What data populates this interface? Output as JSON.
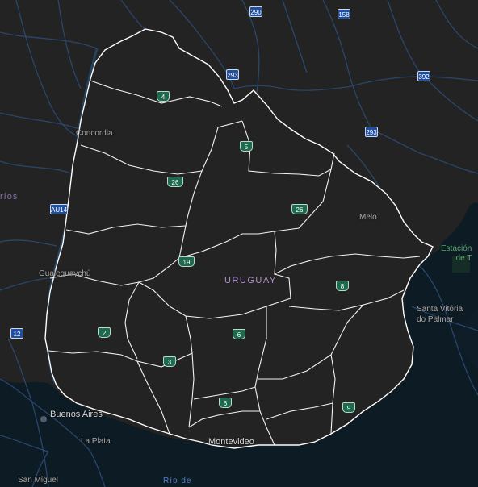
{
  "map": {
    "country_label": "URUGUAY",
    "colors": {
      "land": "#232323",
      "ocean": "#0d1b24",
      "roads": "#2d4d78",
      "borders": "#ffffff",
      "labels": "#a8a8a8"
    },
    "places": [
      {
        "id": "concordia",
        "name": "Concordia"
      },
      {
        "id": "gualeguaychu",
        "name": "Gualeguaychú"
      },
      {
        "id": "melo",
        "name": "Melo"
      },
      {
        "id": "santa-vitoria",
        "name": "Santa Vitória\ndo Palmar"
      },
      {
        "id": "buenos-aires",
        "name": "Buenos Aires"
      },
      {
        "id": "la-plata",
        "name": "La Plata"
      },
      {
        "id": "san-miguel",
        "name": "San Miguel"
      },
      {
        "id": "montevideo",
        "name": "Montevideo"
      }
    ],
    "water_labels": [
      {
        "id": "rio-de",
        "name": "Río de"
      },
      {
        "id": "rios",
        "name": "ríos"
      }
    ],
    "park_label": "Estación\nde T",
    "shields": [
      {
        "id": "290",
        "label": "290",
        "kind": "br"
      },
      {
        "id": "158",
        "label": "158",
        "kind": "br"
      },
      {
        "id": "293a",
        "label": "293",
        "kind": "br"
      },
      {
        "id": "293b",
        "label": "293",
        "kind": "br"
      },
      {
        "id": "392",
        "label": "392",
        "kind": "br"
      },
      {
        "id": "au14",
        "label": "AU14",
        "kind": "ar"
      },
      {
        "id": "12",
        "label": "12",
        "kind": "ar"
      },
      {
        "id": "r4",
        "label": "4",
        "kind": "uy"
      },
      {
        "id": "r5",
        "label": "5",
        "kind": "uy"
      },
      {
        "id": "r26a",
        "label": "26",
        "kind": "uy"
      },
      {
        "id": "r26b",
        "label": "26",
        "kind": "uy"
      },
      {
        "id": "r19",
        "label": "19",
        "kind": "uy"
      },
      {
        "id": "r8",
        "label": "8",
        "kind": "uy"
      },
      {
        "id": "r2",
        "label": "2",
        "kind": "uy"
      },
      {
        "id": "r3",
        "label": "3",
        "kind": "uy"
      },
      {
        "id": "r6a",
        "label": "6",
        "kind": "uy"
      },
      {
        "id": "r6b",
        "label": "6",
        "kind": "uy"
      },
      {
        "id": "r9",
        "label": "9",
        "kind": "uy"
      }
    ]
  }
}
